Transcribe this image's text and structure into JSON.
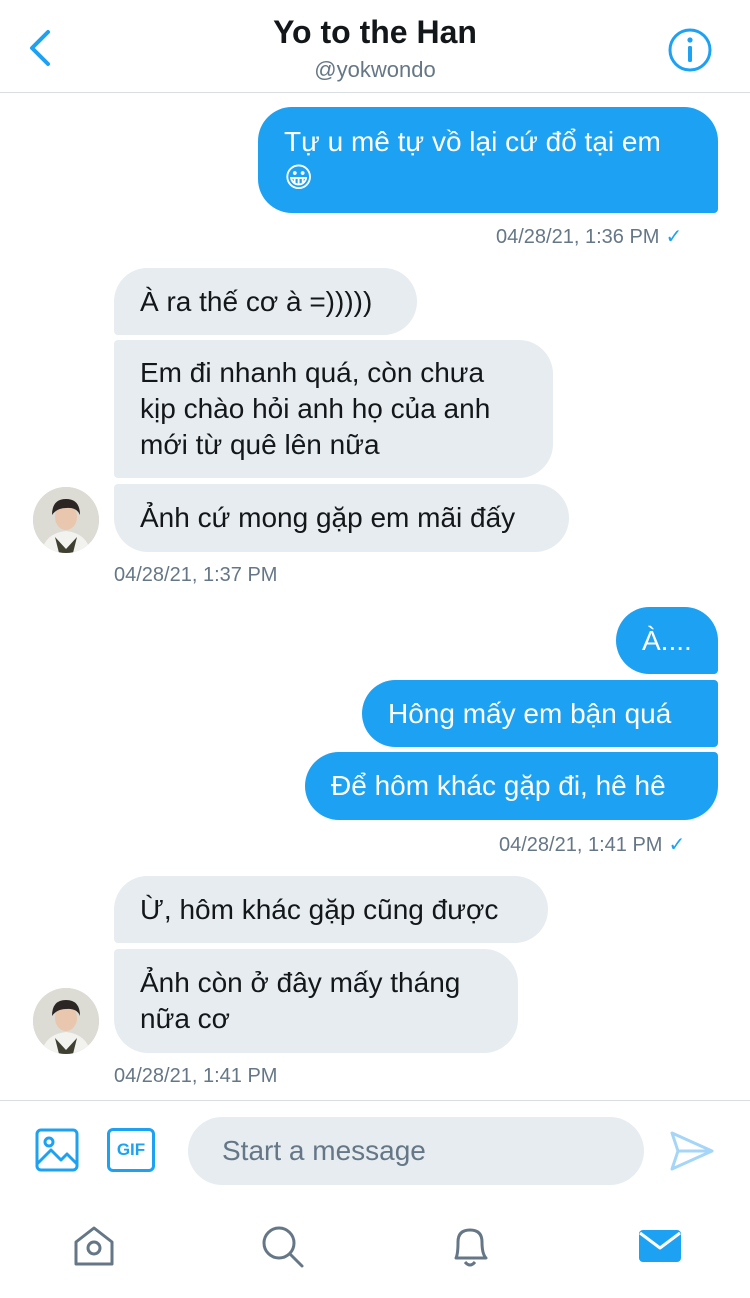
{
  "header": {
    "title": "Yo to the Han",
    "handle": "@yokwondo"
  },
  "messages": [
    {
      "dir": "out",
      "text": "Tự u mê tự vồ lại cứ đổ tại em 😀"
    },
    {
      "dir": "in",
      "text": "À ra thế cơ à =)))))"
    },
    {
      "dir": "in",
      "text": "Em đi nhanh quá, còn chưa kịp chào hỏi anh họ của anh mới từ quê lên nữa"
    },
    {
      "dir": "in",
      "text": "Ảnh cứ mong gặp em mãi đấy"
    },
    {
      "dir": "out",
      "text": "À...."
    },
    {
      "dir": "out",
      "text": "Hông mấy em bận quá"
    },
    {
      "dir": "out",
      "text": "Để hôm khác gặp đi, hê hê"
    },
    {
      "dir": "in",
      "text": "Ừ, hôm khác gặp cũng được"
    },
    {
      "dir": "in",
      "text": "Ảnh còn ở đây mấy tháng nữa cơ"
    }
  ],
  "timestamps": [
    "04/28/21, 1:36 PM",
    "04/28/21, 1:37 PM",
    "04/28/21, 1:41 PM",
    "04/28/21, 1:41 PM"
  ],
  "read_check": "✓",
  "composer": {
    "gif_label": "GIF",
    "placeholder": "Start a message"
  },
  "colors": {
    "accent": "#1da1f2",
    "incoming_bubble": "#e6ecf0",
    "muted_text": "#657786"
  },
  "icons": {
    "back": "chevron-left-icon",
    "info": "info-icon",
    "image": "image-icon",
    "gif": "gif-icon",
    "send": "send-icon",
    "home": "home-icon",
    "search": "search-icon",
    "notifications": "bell-icon",
    "messages": "mail-icon"
  }
}
